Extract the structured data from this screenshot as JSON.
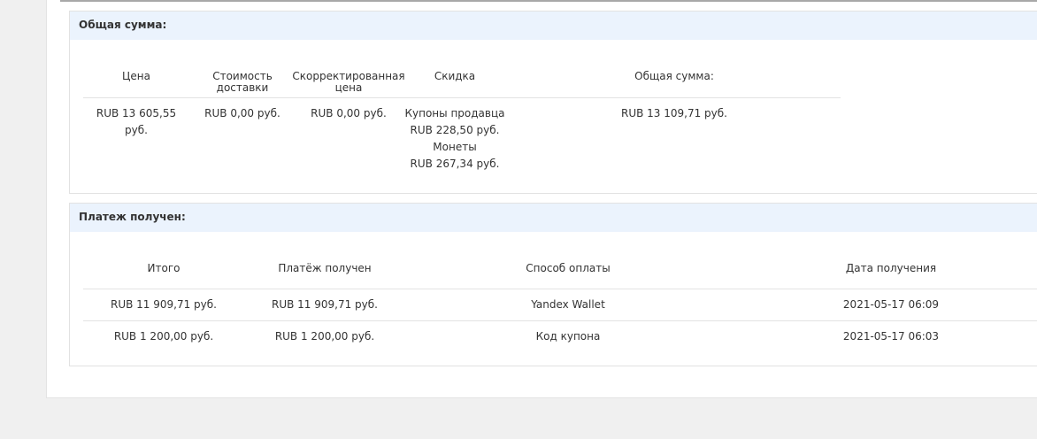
{
  "summary": {
    "title": "Общая сумма:",
    "headers": {
      "price": "Цена",
      "shipping": "Стоимость доставки",
      "adjusted": "Скорректированная цена",
      "discount": "Скидка",
      "total": "Общая сумма:"
    },
    "row": {
      "price": "RUB 13 605,55 руб.",
      "shipping": "RUB 0,00 руб.",
      "adjusted": "RUB 0,00 руб.",
      "discount_lines": [
        "Купоны продавца",
        "RUB 228,50 руб.",
        "Монеты",
        "RUB 267,34 руб."
      ],
      "total": "RUB 13 109,71 руб."
    }
  },
  "payment": {
    "title": "Платеж получен:",
    "headers": {
      "subtotal": "Итого",
      "received": "Платёж получен",
      "method": "Способ оплаты",
      "date": "Дата получения"
    },
    "rows": [
      {
        "subtotal": "RUB 11 909,71 руб.",
        "received": "RUB 11 909,71 руб.",
        "method": "Yandex Wallet",
        "date": "2021-05-17 06:09"
      },
      {
        "subtotal": "RUB 1 200,00 руб.",
        "received": "RUB 1 200,00 руб.",
        "method": "Код купона",
        "date": "2021-05-17 06:03"
      }
    ]
  },
  "colors": {
    "page_bg": "#f0f0f0",
    "panel_header_bg": "#ebf3fd",
    "border": "#e2e2e2",
    "text": "#333333"
  }
}
